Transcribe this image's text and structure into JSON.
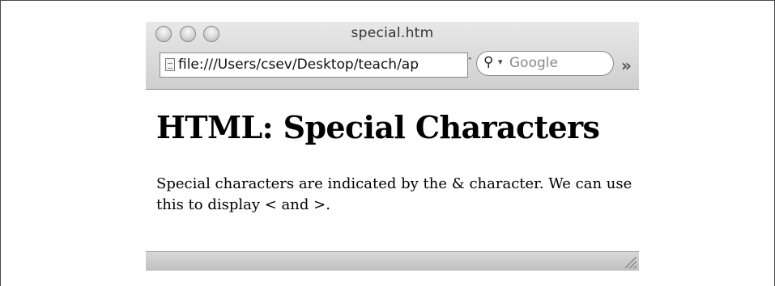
{
  "window": {
    "title": "special.htm"
  },
  "toolbar": {
    "url": "file:///Users/csev/Desktop/teach/ap",
    "url_menu_icon": "chevron-up-small",
    "search_placeholder": "Google",
    "search_icon": "magnifier-with-dropdown",
    "overflow_icon": "double-chevron-right"
  },
  "page": {
    "heading": "HTML: Special Characters",
    "paragraph": "Special characters are indicated by the & character. We can use this to display < and >."
  },
  "statusbar": {
    "resize_icon": "resize-grip"
  }
}
